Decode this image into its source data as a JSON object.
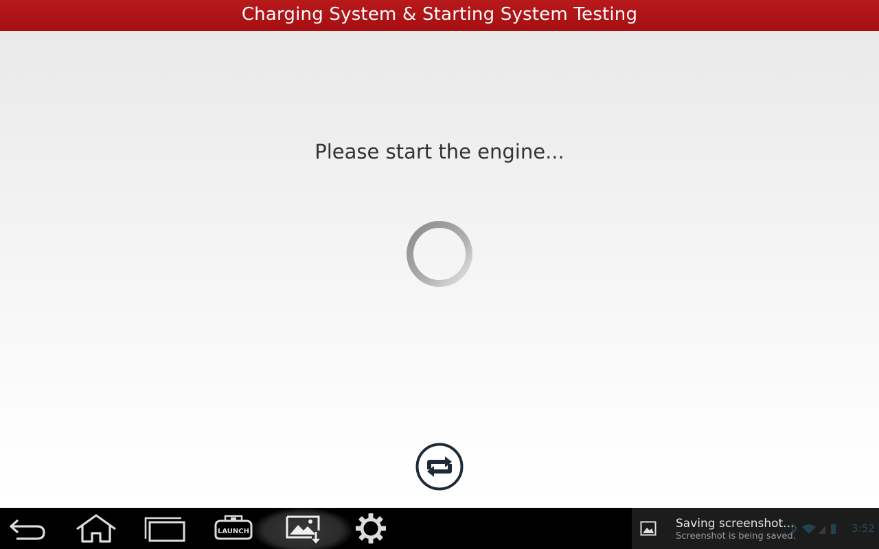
{
  "header": {
    "title": "Charging System & Starting System Testing"
  },
  "main": {
    "message": "Please start the engine...",
    "spinner_icon": "loading-spinner-icon",
    "refresh_icon": "refresh-icon"
  },
  "navbar": {
    "buttons": [
      {
        "icon": "back-icon"
      },
      {
        "icon": "home-icon"
      },
      {
        "icon": "recent-apps-icon"
      },
      {
        "icon": "launch-icon",
        "label": "LAUNCH"
      },
      {
        "icon": "screenshot-icon"
      },
      {
        "icon": "settings-icon"
      }
    ]
  },
  "notification": {
    "title": "Saving screenshot...",
    "subtitle": "Screenshot is being saved.",
    "icon": "image-icon"
  },
  "status": {
    "time": "3:52"
  },
  "colors": {
    "title_bar": "#b0151a",
    "accent": "#33b5e5",
    "refresh_icon": "#1e2a36"
  }
}
